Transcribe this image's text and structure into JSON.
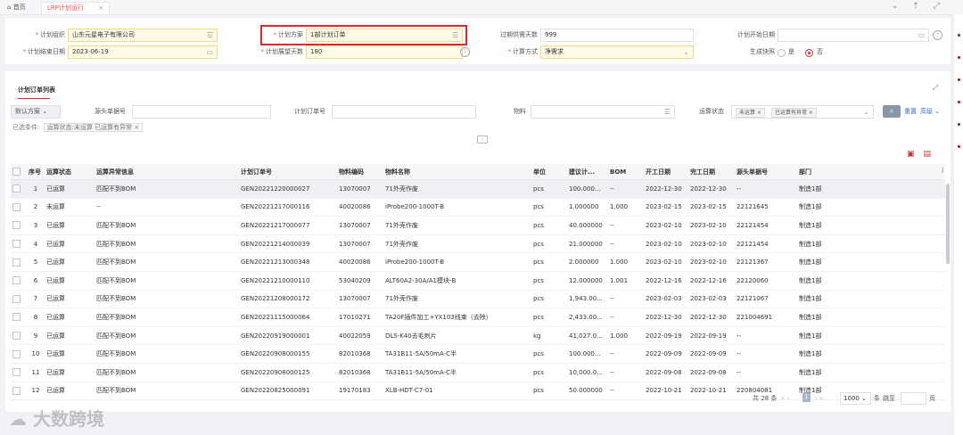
{
  "tabs": {
    "home": "首页",
    "active": "LRP计划运行",
    "close": "×"
  },
  "form": {
    "plan_org": {
      "label": "计划组织",
      "value": "山东元星电子有限公司"
    },
    "plan_scheme": {
      "label": "计划方案",
      "value": "1部计划订单"
    },
    "overdue_days": {
      "label": "过期供需天数",
      "value": "999"
    },
    "plan_start": {
      "label": "计划开始日期",
      "value": ""
    },
    "plan_end": {
      "label": "计划结束日期",
      "value": "2023-06-19"
    },
    "horizon_days": {
      "label": "计划展望天数",
      "value": "180"
    },
    "calc_method": {
      "label": "计算方式",
      "value": "净需求"
    },
    "snapshot": {
      "label": "生成快照",
      "opt_yes": "是",
      "opt_no": "否",
      "selected": "否"
    }
  },
  "list": {
    "title": "计划订单列表",
    "scheme": "默认方案",
    "f_source": "源头单据号",
    "f_order": "计划订单号",
    "f_material": "物料",
    "f_status": "运算状态",
    "tag1": "未运算 ×",
    "tag2": "已运算有异常 ×",
    "reset": "重置",
    "advanced": "高级",
    "cond_label": "已选条件:",
    "cond_tag": "运算状态:未运算 已运算有异常",
    "cond_close": "×"
  },
  "columns": [
    "序号",
    "运算状态",
    "运算异常信息",
    "计划订单号",
    "物料编码",
    "物料名称",
    "单位",
    "建议计...",
    "BOM",
    "开工日期",
    "完工日期",
    "源头单据号",
    "部门"
  ],
  "rows": [
    [
      "1",
      "已运算",
      "匹配不到BOM",
      "GEN20221220000027",
      "13070007",
      "71外壳作废",
      "pcs",
      "100.000...",
      "--",
      "2022-12-30",
      "2022-12-30",
      "--",
      "制造1部"
    ],
    [
      "2",
      "未运算",
      "--",
      "GEN20221217000116",
      "40020086",
      "iProbe200-1000T-B",
      "pcs",
      "1.000000",
      "1.000",
      "2023-02-15",
      "2023-02-15",
      "22121645",
      "制造1部"
    ],
    [
      "3",
      "已运算",
      "匹配不到BOM",
      "GEN20221217000077",
      "13070007",
      "71外壳作废",
      "pcs",
      "40.000000",
      "--",
      "2023-02-10",
      "2023-02-10",
      "22121454",
      "制造1部"
    ],
    [
      "4",
      "已运算",
      "匹配不到BOM",
      "GEN20221214000039",
      "13070007",
      "71外壳作废",
      "pcs",
      "21.000000",
      "--",
      "2023-02-10",
      "2023-02-10",
      "22121454",
      "制造1部"
    ],
    [
      "5",
      "已运算",
      "匹配不到BOM",
      "GEN20221213000348",
      "40020086",
      "iProbe200-1000T-B",
      "pcs",
      "2.000000",
      "1.000",
      "2023-02-10",
      "2023-02-10",
      "22121367",
      "制造1部"
    ],
    [
      "6",
      "已运算",
      "匹配不到BOM",
      "GEN20221210000110",
      "53040209",
      "ALT60A2-30A/A1模块-B",
      "pcs",
      "12.000000",
      "1.001",
      "2022-12-16",
      "2022-12-16",
      "22120060",
      "制造1部"
    ],
    [
      "7",
      "已运算",
      "匹配不到BOM",
      "GEN20221208000172",
      "13070007",
      "71外壳作废",
      "pcs",
      "1,943.00...",
      "--",
      "2023-02-03",
      "2023-02-03",
      "22121067",
      "制造1部"
    ],
    [
      "8",
      "已运算",
      "匹配不到BOM",
      "GEN20221115000064",
      "17010271",
      "TA20F插件加工+YX103线束（去除）",
      "pcs",
      "2,433.00...",
      "--",
      "2022-12-30",
      "2022-12-30",
      "221004691",
      "制造1部"
    ],
    [
      "9",
      "已运算",
      "匹配不到BOM",
      "GEN20220919000001",
      "40022059",
      "DLS-K40去毛刺片",
      "kg",
      "41,027.0...",
      "1.000",
      "2022-09-19",
      "2022-09-19",
      "--",
      "制造1部"
    ],
    [
      "10",
      "已运算",
      "匹配不到BOM",
      "GEN20220908000155",
      "82010368",
      "TA31B11-5A/50mA-C半",
      "pcs",
      "100.000...",
      "--",
      "2022-09-09",
      "2022-09-09",
      "--",
      "制造1部"
    ],
    [
      "11",
      "已运算",
      "匹配不到BOM",
      "GEN20220908000125",
      "82010368",
      "TA31B11-5A/50mA-C半",
      "pcs",
      "10,000.0...",
      "--",
      "2022-09-08",
      "2022-09-08",
      "--",
      "制造1部"
    ],
    [
      "12",
      "已运算",
      "匹配不到BOM",
      "GEN20220825000091",
      "19170183",
      "XLB-HDT-C7-01",
      "pcs",
      "50.000000",
      "--",
      "2022-10-21",
      "2022-10-21",
      "220804081",
      "制造1部"
    ]
  ],
  "pager": {
    "total": "共 28 条",
    "page": "1",
    "size": "1000",
    "size_unit": "条",
    "jump": "跳至",
    "page_unit": "页"
  },
  "watermark": "大数跨境",
  "colors": {
    "accent": "#e3262b",
    "link": "#3a6fd8",
    "required_bg": "#fffbe6"
  }
}
